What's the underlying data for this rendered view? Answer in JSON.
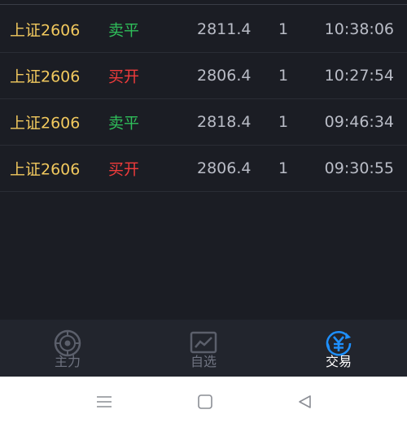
{
  "trades": [
    {
      "name": "上证2606",
      "action": "卖平",
      "side": "sell",
      "price": "2811.4",
      "qty": "1",
      "time": "10:38:06"
    },
    {
      "name": "上证2606",
      "action": "买开",
      "side": "buy",
      "price": "2806.4",
      "qty": "1",
      "time": "10:27:54"
    },
    {
      "name": "上证2606",
      "action": "卖平",
      "side": "sell",
      "price": "2818.4",
      "qty": "1",
      "time": "09:46:34"
    },
    {
      "name": "上证2606",
      "action": "买开",
      "side": "buy",
      "price": "2806.4",
      "qty": "1",
      "time": "09:30:55"
    }
  ],
  "tabs": [
    {
      "label": "主力",
      "icon": "target-icon",
      "active": false
    },
    {
      "label": "自选",
      "icon": "chart-icon",
      "active": false
    },
    {
      "label": "交易",
      "icon": "yen-icon",
      "active": true
    }
  ],
  "colors": {
    "sell": "#2fbf5a",
    "buy": "#ef3b3b",
    "name": "#f2c95e",
    "accent": "#1e90ff"
  },
  "system_nav": [
    {
      "icon": "menu-icon"
    },
    {
      "icon": "home-icon"
    },
    {
      "icon": "back-icon"
    }
  ]
}
